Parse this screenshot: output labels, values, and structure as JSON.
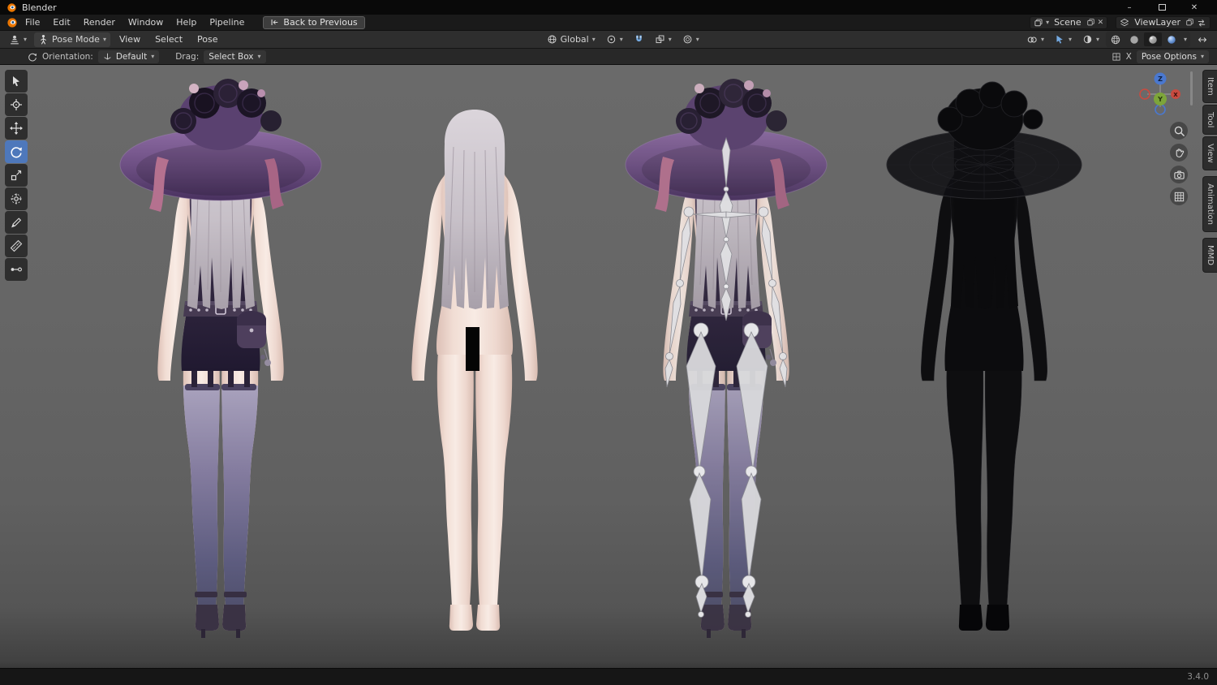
{
  "icons": {
    "chevron_down": "▾",
    "minimize": "–",
    "close": "✕",
    "unlink": "✕"
  },
  "colors": {
    "active_tool": "#4e78bb",
    "snap_active": "#74aae2",
    "axis_x": "#c84b40",
    "axis_y": "#7da53a",
    "axis_z": "#4a78cf",
    "viewport_background": "#636363"
  },
  "titlebar": {
    "app_title": "Blender"
  },
  "menubar": {
    "menus": [
      "File",
      "Edit",
      "Render",
      "Window",
      "Help",
      "Pipeline"
    ],
    "back_label": "Back to Previous",
    "scene_label": "Scene",
    "viewlayer_label": "ViewLayer"
  },
  "viewport_header": {
    "mode_label": "Pose Mode",
    "menus": [
      "View",
      "Select",
      "Pose"
    ],
    "orientation_label": "Global"
  },
  "tool_settings": {
    "orientation_label": "Orientation:",
    "orientation_value": "Default",
    "drag_label": "Drag:",
    "drag_value": "Select Box",
    "x_mirror_label": "X",
    "pose_options_label": "Pose Options"
  },
  "toolbar": {
    "tools": [
      "tweak",
      "cursor",
      "move",
      "rotate",
      "scale",
      "transform",
      "annotate",
      "measure",
      "pose-breakdowner"
    ],
    "active_tool": "rotate"
  },
  "viewport": {
    "models": [
      "dressed-character",
      "base-body",
      "posed-armature-character",
      "wireframe-character"
    ]
  },
  "nav_gizmo": {
    "x_label": "X",
    "y_label": "Y",
    "z_label": "Z"
  },
  "sidebar_tabs": [
    "Item",
    "Tool",
    "View",
    "Animation",
    "MMD"
  ],
  "statusbar": {
    "version": "3.4.0"
  }
}
